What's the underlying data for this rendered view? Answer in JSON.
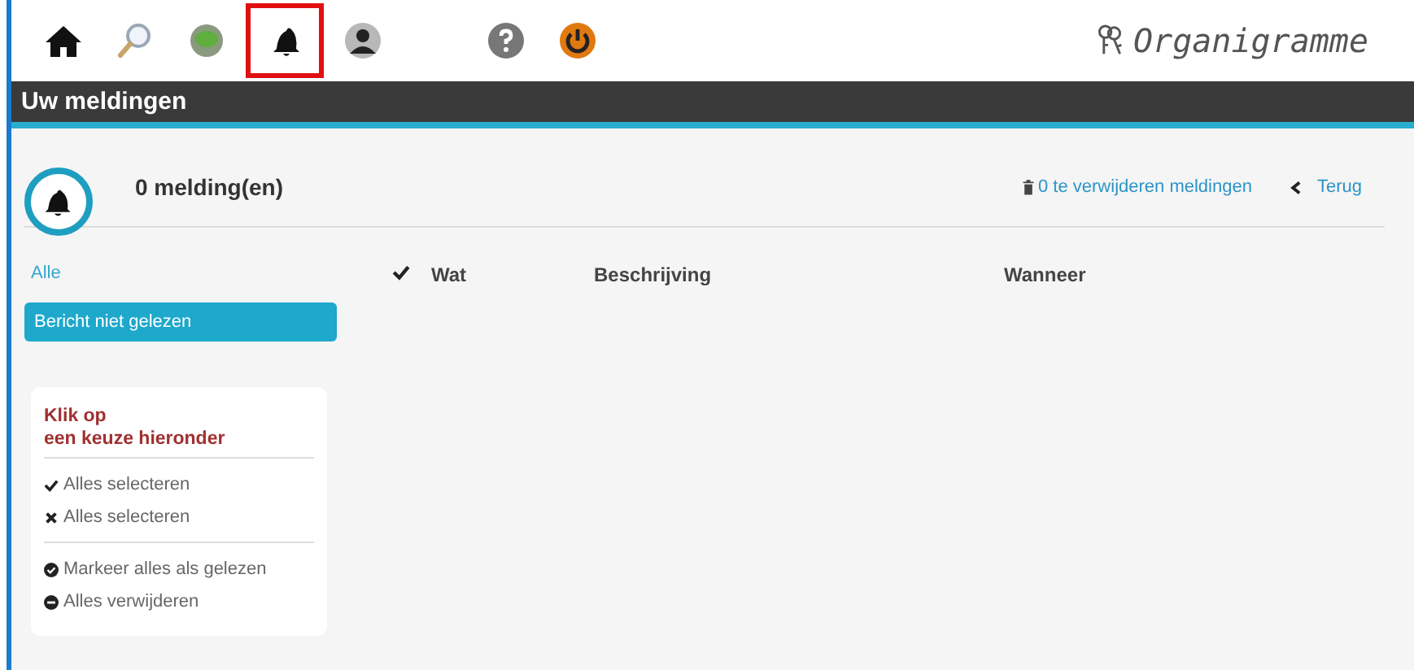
{
  "toolbar": {
    "icons": [
      {
        "kind": "home",
        "highlighted": false
      },
      {
        "kind": "search",
        "highlighted": false
      },
      {
        "kind": "chat",
        "highlighted": false
      },
      {
        "kind": "bell",
        "highlighted": true
      },
      {
        "kind": "user",
        "highlighted": false
      },
      {
        "kind": "help",
        "highlighted": false
      },
      {
        "kind": "power",
        "highlighted": false
      }
    ],
    "brand": "Organigramme"
  },
  "header": {
    "title": "Uw meldingen"
  },
  "summary": {
    "count": "0 melding(en)",
    "delete_link": "0 te verwijderen meldingen",
    "back_link": "Terug"
  },
  "filters": [
    {
      "label": "Alle",
      "selected": false
    },
    {
      "label": "Bericht niet gelezen",
      "selected": true
    }
  ],
  "actions_card": {
    "title_lines": [
      "Klik op",
      "een keuze hieronder"
    ],
    "groups": [
      [
        {
          "kind": "check",
          "label": "Alles selecteren"
        },
        {
          "kind": "cross",
          "label": "Alles selecteren"
        }
      ],
      [
        {
          "kind": "mark-read",
          "label": "Markeer alles als gelezen"
        },
        {
          "kind": "delete",
          "label": "Alles verwijderen"
        }
      ]
    ]
  },
  "table": {
    "columns": [
      {
        "kind": "check"
      },
      {
        "kind": "text",
        "label": "Wat"
      },
      {
        "kind": "text",
        "label": "Beschrijving"
      },
      {
        "kind": "text",
        "label": "Wanneer"
      }
    ]
  }
}
